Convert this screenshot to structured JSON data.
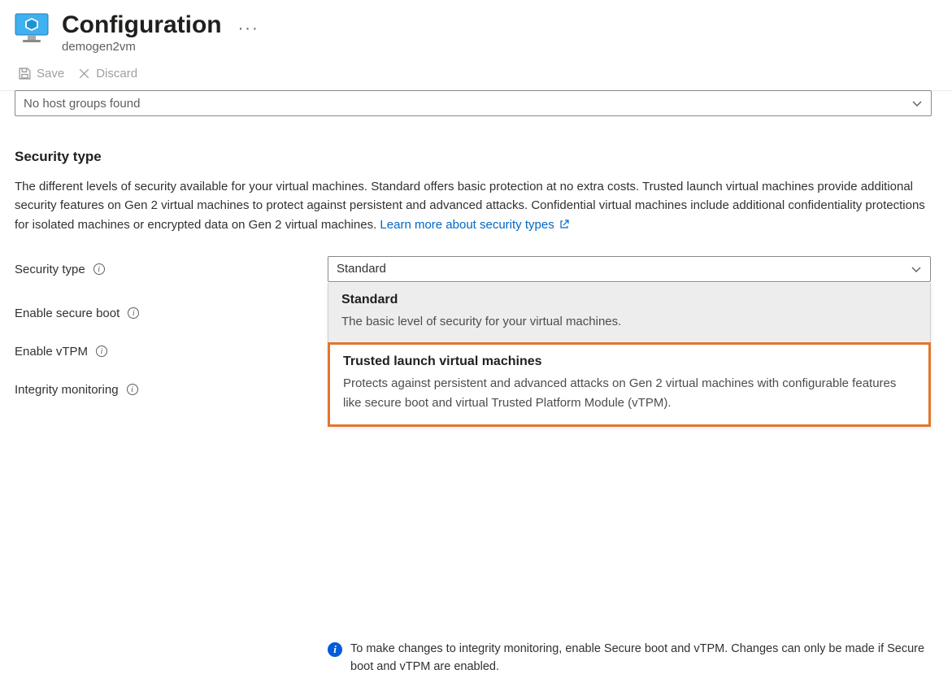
{
  "header": {
    "title": "Configuration",
    "subtitle": "demogen2vm",
    "more": "···"
  },
  "toolbar": {
    "save_label": "Save",
    "discard_label": "Discard"
  },
  "host_group_select": {
    "placeholder": "No host groups found"
  },
  "section": {
    "heading": "Security type",
    "description": "The different levels of security available for your virtual machines. Standard offers basic protection at no extra costs. Trusted launch virtual machines provide additional security features on Gen 2 virtual machines to protect against persistent and advanced attacks. Confidential virtual machines include additional confidentiality protections for isolated machines or encrypted data on Gen 2 virtual machines.",
    "link_text": "Learn more about security types"
  },
  "fields": {
    "security_type": {
      "label": "Security type",
      "value": "Standard"
    },
    "secure_boot": {
      "label": "Enable secure boot"
    },
    "vtpm": {
      "label": "Enable vTPM"
    },
    "integrity": {
      "label": "Integrity monitoring"
    }
  },
  "dropdown": {
    "options": [
      {
        "title": "Standard",
        "desc": "The basic level of security for your virtual machines."
      },
      {
        "title": "Trusted launch virtual machines",
        "desc": "Protects against persistent and advanced attacks on Gen 2 virtual machines with configurable features like secure boot and virtual Trusted Platform Module (vTPM)."
      }
    ]
  },
  "callout": {
    "text": "To make changes to integrity monitoring, enable Secure boot and vTPM. Changes can only be made if Secure boot and vTPM are enabled."
  }
}
